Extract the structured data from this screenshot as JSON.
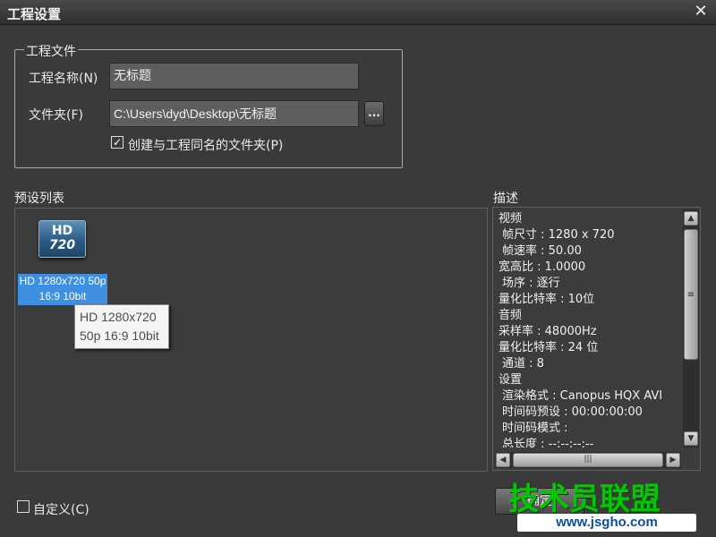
{
  "window": {
    "title": "工程设置",
    "close_label": "✕"
  },
  "project_file": {
    "legend": "工程文件",
    "name_label": "工程名称(N)",
    "name_value": "无标题",
    "folder_label": "文件夹(F)",
    "folder_value": "C:\\Users\\dyd\\Desktop\\无标题",
    "browse_label": "...",
    "create_folder_checked": true,
    "create_folder_check_glyph": "✓",
    "create_folder_label": "创建与工程同名的文件夹(P)"
  },
  "presets": {
    "heading": "预设列表",
    "items": [
      {
        "icon_top": "HD",
        "icon_bottom": "720",
        "label_line1": "HD 1280x720 50p",
        "label_line2": "16:9 10bit",
        "selected": true
      }
    ],
    "tooltip_line1": "HD 1280x720",
    "tooltip_line2": "50p 16:9 10bit"
  },
  "description": {
    "heading": "描述",
    "lines": [
      {
        "text": "视频",
        "indent": false
      },
      {
        "text": "帧尺寸 : 1280 x 720",
        "indent": true
      },
      {
        "text": "帧速率 : 50.00",
        "indent": true
      },
      {
        "text": "宽高比 : 1.0000",
        "indent": false
      },
      {
        "text": "场序 : 逐行",
        "indent": true
      },
      {
        "text": "量化比特率 : 10位",
        "indent": false
      },
      {
        "text": "音频",
        "indent": false
      },
      {
        "text": "采样率 : 48000Hz",
        "indent": false
      },
      {
        "text": "量化比特率 : 24 位",
        "indent": false
      },
      {
        "text": "通道 : 8",
        "indent": true
      },
      {
        "text": "设置",
        "indent": false
      },
      {
        "text": "渲染格式 : Canopus HQX AVI",
        "indent": true
      },
      {
        "text": "时间码预设 : 00:00:00:00",
        "indent": true
      },
      {
        "text": "时间码模式 :",
        "indent": true
      },
      {
        "text": "总长度 : --:--:--:--",
        "indent": true
      }
    ]
  },
  "custom": {
    "label": "自定义(C)",
    "checked": false
  },
  "buttons": {
    "ok_label": "确定"
  },
  "watermark": {
    "logo_text": "技术员联盟",
    "url": "www.jsgho.com",
    "color": "#00c800"
  },
  "colors": {
    "background": "#3a3a3a",
    "selection": "#3e8fe0"
  }
}
